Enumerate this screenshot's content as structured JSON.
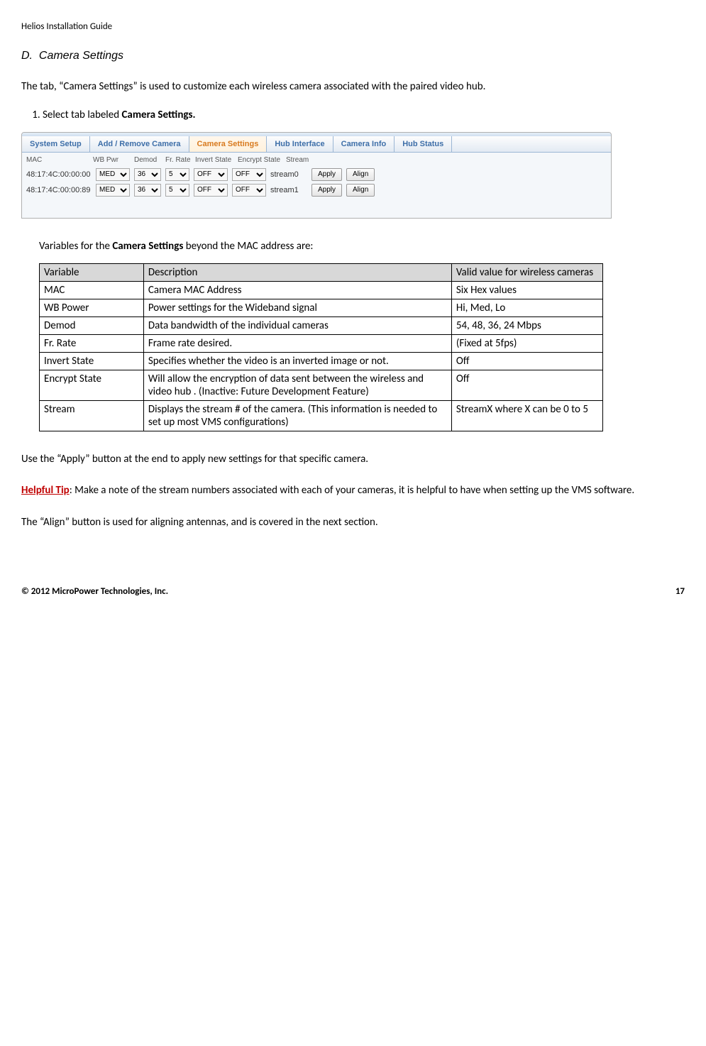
{
  "header": "Helios Installation Guide",
  "section": {
    "letter": "D.",
    "title": "Camera Settings"
  },
  "intro": "The tab, “Camera Settings” is used to customize each wireless camera associated with the paired video hub.",
  "step1_pre": "Select tab labeled ",
  "step1_bold": "Camera Settings.",
  "screenshot": {
    "tabs": [
      "System Setup",
      "Add / Remove Camera",
      "Camera Settings",
      "Hub Interface",
      "Camera Info",
      "Hub Status"
    ],
    "active_tab_index": 2,
    "col_headers": [
      "MAC",
      "WB Pwr",
      "Demod",
      "Fr. Rate",
      "Invert State",
      "Encrypt State",
      "Stream"
    ],
    "rows": [
      {
        "mac": "48:17:4C:00:00:00",
        "wb": "MED",
        "demod": "36",
        "fr": "5",
        "invert": "OFF",
        "encrypt": "OFF",
        "stream": "stream0"
      },
      {
        "mac": "48:17:4C:00:00:89",
        "wb": "MED",
        "demod": "36",
        "fr": "5",
        "invert": "OFF",
        "encrypt": "OFF",
        "stream": "stream1"
      }
    ],
    "apply_label": "Apply",
    "align_label": "Align"
  },
  "vars_intro_pre": "Variables for the ",
  "vars_intro_bold": "Camera Settings",
  "vars_intro_post": " beyond the MAC address are:",
  "table": {
    "headers": [
      "Variable",
      "Description",
      "Valid value for wireless cameras"
    ],
    "rows": [
      {
        "var": "MAC",
        "desc": "Camera MAC Address",
        "val": "Six Hex values"
      },
      {
        "var": "WB Power",
        "desc": "Power settings for the Wideband signal",
        "val": "Hi, Med, Lo"
      },
      {
        "var": "Demod",
        "desc": "Data bandwidth of the individual cameras",
        "val": "54, 48, 36, 24 Mbps"
      },
      {
        "var": "Fr. Rate",
        "desc": "Frame rate desired.",
        "val": "(Fixed at 5fps)"
      },
      {
        "var": "Invert State",
        "desc": "Specifies whether the video is an inverted image or not.",
        "val": "Off"
      },
      {
        "var": "Encrypt State",
        "desc": "Will allow the encryption of data sent between the wireless and video hub . (Inactive: Future Development Feature)",
        "val": "Off"
      },
      {
        "var": "Stream",
        "desc": "Displays the stream # of the camera. (This information is needed to set up most VMS configurations)",
        "val": "StreamX where X can be 0 to 5"
      }
    ]
  },
  "apply_text": "Use the “Apply” button at the end to apply new settings for that specific camera.",
  "tip_label": "Helpful Tip",
  "tip_text": ":  Make a note of the stream numbers associated with each of your cameras, it is helpful to have when setting up the VMS software.",
  "align_text": "The “Align” button is used for aligning antennas, and is covered in the next section.",
  "footer_left": "© 2012 MicroPower Technologies, Inc.",
  "footer_right": "17"
}
